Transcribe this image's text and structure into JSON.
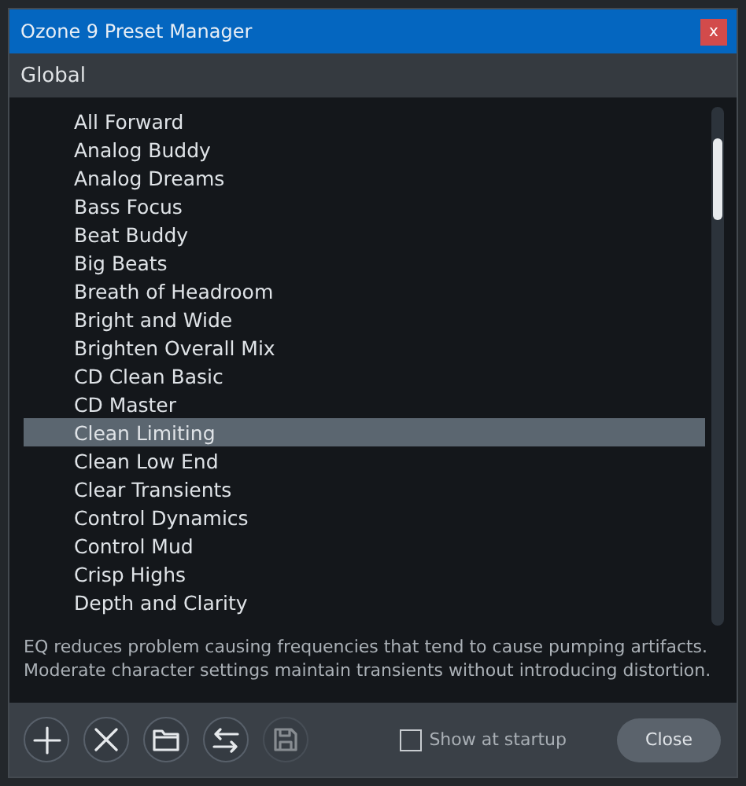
{
  "window": {
    "title": "Ozone 9 Preset Manager",
    "close_label": "x"
  },
  "group": {
    "title": "Global"
  },
  "presets": [
    {
      "label": "All Forward",
      "selected": false
    },
    {
      "label": "Analog Buddy",
      "selected": false
    },
    {
      "label": "Analog Dreams",
      "selected": false
    },
    {
      "label": "Bass Focus",
      "selected": false
    },
    {
      "label": "Beat Buddy",
      "selected": false
    },
    {
      "label": "Big Beats",
      "selected": false
    },
    {
      "label": "Breath of Headroom",
      "selected": false
    },
    {
      "label": "Bright and Wide",
      "selected": false
    },
    {
      "label": "Brighten Overall Mix",
      "selected": false
    },
    {
      "label": "CD Clean Basic",
      "selected": false
    },
    {
      "label": "CD Master",
      "selected": false
    },
    {
      "label": "Clean Limiting",
      "selected": true
    },
    {
      "label": "Clean Low End",
      "selected": false
    },
    {
      "label": "Clear Transients",
      "selected": false
    },
    {
      "label": "Control Dynamics",
      "selected": false
    },
    {
      "label": "Control Mud",
      "selected": false
    },
    {
      "label": "Crisp Highs",
      "selected": false
    },
    {
      "label": "Depth and Clarity",
      "selected": false
    }
  ],
  "description": "EQ reduces problem causing frequencies that tend to cause pumping artifacts. Moderate character settings maintain transients without introducing distortion.",
  "toolbar": [
    {
      "kind": "add",
      "disabled": false
    },
    {
      "kind": "delete",
      "disabled": false
    },
    {
      "kind": "folder",
      "disabled": false
    },
    {
      "kind": "swap",
      "disabled": false
    },
    {
      "kind": "save",
      "disabled": true
    }
  ],
  "show_at_startup": {
    "label": "Show at startup",
    "checked": false
  },
  "close_button": {
    "label": "Close"
  }
}
